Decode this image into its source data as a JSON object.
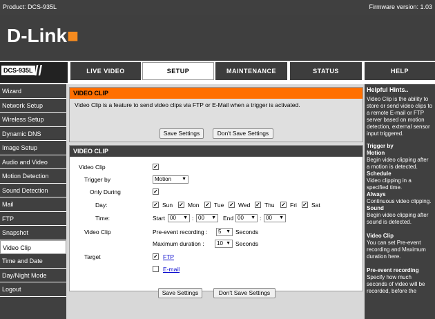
{
  "header": {
    "product": "Product: DCS-935L",
    "firmware": "Firmware version: 1.03"
  },
  "brand": {
    "logo_text": "D-Link",
    "model_label": "DCS-935L"
  },
  "tabs": [
    "LIVE VIDEO",
    "SETUP",
    "MAINTENANCE",
    "STATUS",
    "HELP"
  ],
  "sidebar": {
    "items": [
      "Wizard",
      "Network Setup",
      "Wireless Setup",
      "Dynamic DNS",
      "Image Setup",
      "Audio and Video",
      "Motion Detection",
      "Sound Detection",
      "Mail",
      "FTP",
      "Snapshot",
      "Video Clip",
      "Time and Date",
      "Day/Night Mode",
      "Logout"
    ],
    "active": "Video Clip"
  },
  "section1": {
    "title": "VIDEO CLIP",
    "description": "Video Clip is a feature to send video clips via FTP or E-Mail when a trigger is activated.",
    "save": "Save Settings",
    "dont_save": "Don't Save Settings"
  },
  "section2": {
    "title": "VIDEO CLIP",
    "video_clip_label": "Video Clip",
    "trigger_label": "Trigger by",
    "trigger_value": "Motion",
    "only_during_label": "Only During",
    "day_label": "Day:",
    "days": [
      "Sun",
      "Mon",
      "Tue",
      "Wed",
      "Thu",
      "Fri",
      "Sat"
    ],
    "time_label": "Time:",
    "start_label": "Start",
    "end_label": "End",
    "start_h": "00",
    "start_m": "00",
    "end_h": "00",
    "end_m": "00",
    "colon": ":",
    "clip_label": "Video Clip",
    "pre_event_label": "Pre-event recording :",
    "pre_event_value": "5",
    "max_dur_label": "Maximum duration :",
    "max_dur_value": "10",
    "seconds": "Seconds",
    "target_label": "Target",
    "ftp": "FTP",
    "email": "E-mail",
    "check": "✓"
  },
  "footer_buttons": {
    "save": "Save Settings",
    "dont_save": "Don't Save Settings"
  },
  "hints": {
    "title": "Helpful Hints..",
    "intro": "Video Clip is the ability to store or send video clips to a remote E-mail or FTP server based on motion detection, external sensor input triggered.",
    "trigger_h": "Trigger by",
    "motion_h": "Motion",
    "motion_t": "Begin video clipping after a motion is detected.",
    "schedule_h": "Schedule",
    "schedule_t": "Video clipping in a specified time.",
    "always_h": "Always",
    "always_t": "Continuous video clipping.",
    "sound_h": "Sound",
    "sound_t": "Begin video clipping after sound is detected.",
    "vclip_h": "Video Clip",
    "vclip_t": "You can set Pre-event recording and Maximum duration here.",
    "pre_h": "Pre-event recording",
    "pre_t": "Specify how much seconds of video will be recorded, before the"
  },
  "colors": {
    "accent": "#ff6f00",
    "dark": "#404040",
    "link": "#0000cc"
  }
}
